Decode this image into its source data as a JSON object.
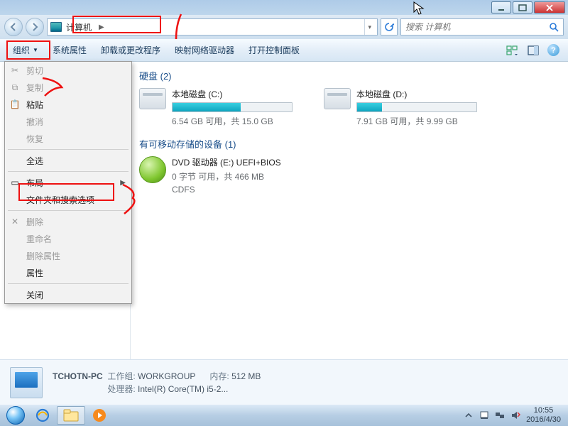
{
  "titlebar": {},
  "address": {
    "location": "计算机",
    "search_placeholder": "搜索 计算机"
  },
  "toolbar": {
    "organize": "组织",
    "sys_props": "系统属性",
    "uninstall": "卸载或更改程序",
    "map_drive": "映射网络驱动器",
    "control_panel": "打开控制面板"
  },
  "org_menu": {
    "cut": "剪切",
    "copy": "复制",
    "paste": "粘贴",
    "undo": "撤消",
    "redo": "恢复",
    "select_all": "全选",
    "layout": "布局",
    "folder_options": "文件夹和搜索选项",
    "delete": "删除",
    "rename": "重命名",
    "remove_props": "删除属性",
    "properties": "属性",
    "close": "关闭"
  },
  "content": {
    "hd_header": "硬盘 (2)",
    "drives": [
      {
        "label": "本地磁盘 (C:)",
        "stat": "6.54 GB 可用，共 15.0 GB",
        "fill": 57
      },
      {
        "label": "本地磁盘 (D:)",
        "stat": "7.91 GB 可用，共 9.99 GB",
        "fill": 21
      }
    ],
    "removable_header": "有可移动存储的设备 (1)",
    "dvd": {
      "label": "DVD 驱动器 (E:) UEFI+BIOS",
      "stat": "0 字节 可用，共 466 MB",
      "fs": "CDFS"
    }
  },
  "details": {
    "name": "TCHOTN-PC",
    "workgroup_k": "工作组:",
    "workgroup_v": "WORKGROUP",
    "mem_k": "内存:",
    "mem_v": "512 MB",
    "cpu_k": "处理器:",
    "cpu_v": "Intel(R) Core(TM) i5-2..."
  },
  "taskbar": {
    "time": "10:55",
    "date": "2016/4/30"
  }
}
